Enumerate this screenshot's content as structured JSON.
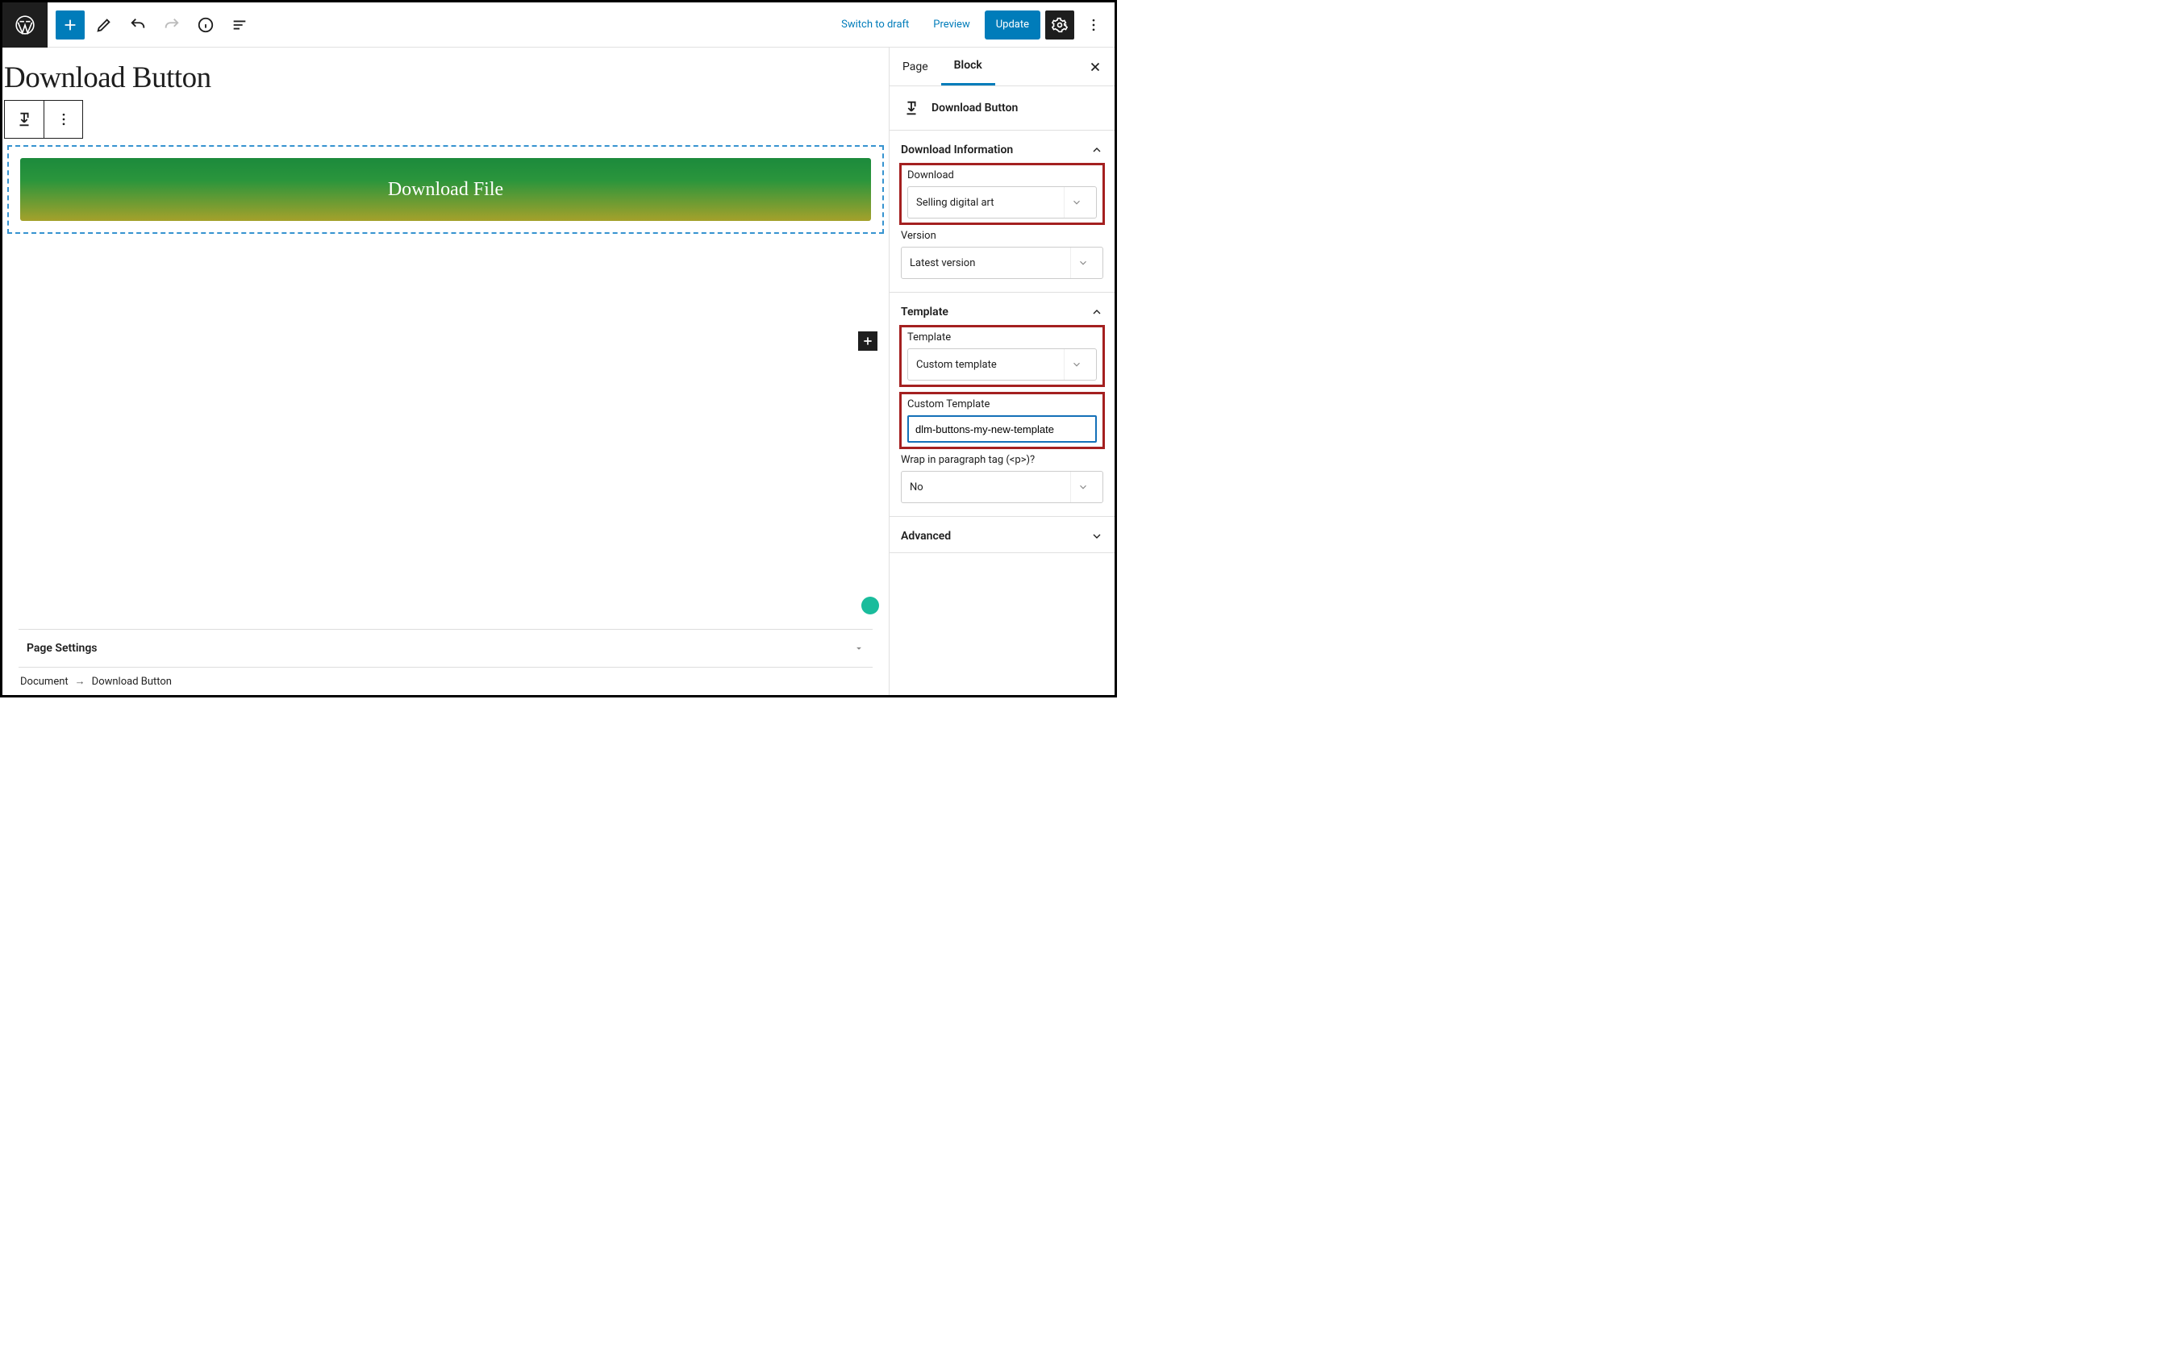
{
  "topbar": {
    "switch_to_draft": "Switch to draft",
    "preview": "Preview",
    "update": "Update"
  },
  "editor": {
    "title": "Download Button",
    "download_button_label": "Download File",
    "page_settings_label": "Page Settings"
  },
  "breadcrumb": {
    "root": "Document",
    "current": "Download Button"
  },
  "sidebar": {
    "tabs": {
      "page": "Page",
      "block": "Block"
    },
    "block_title": "Download Button",
    "panels": {
      "download_info": {
        "title": "Download Information",
        "download_label": "Download",
        "download_value": "Selling digital art",
        "version_label": "Version",
        "version_value": "Latest version"
      },
      "template": {
        "title": "Template",
        "template_label": "Template",
        "template_value": "Custom template",
        "custom_template_label": "Custom Template",
        "custom_template_value": "dlm-buttons-my-new-template",
        "wrap_label": "Wrap in paragraph tag (<p>)?",
        "wrap_value": "No"
      },
      "advanced": {
        "title": "Advanced"
      }
    }
  }
}
